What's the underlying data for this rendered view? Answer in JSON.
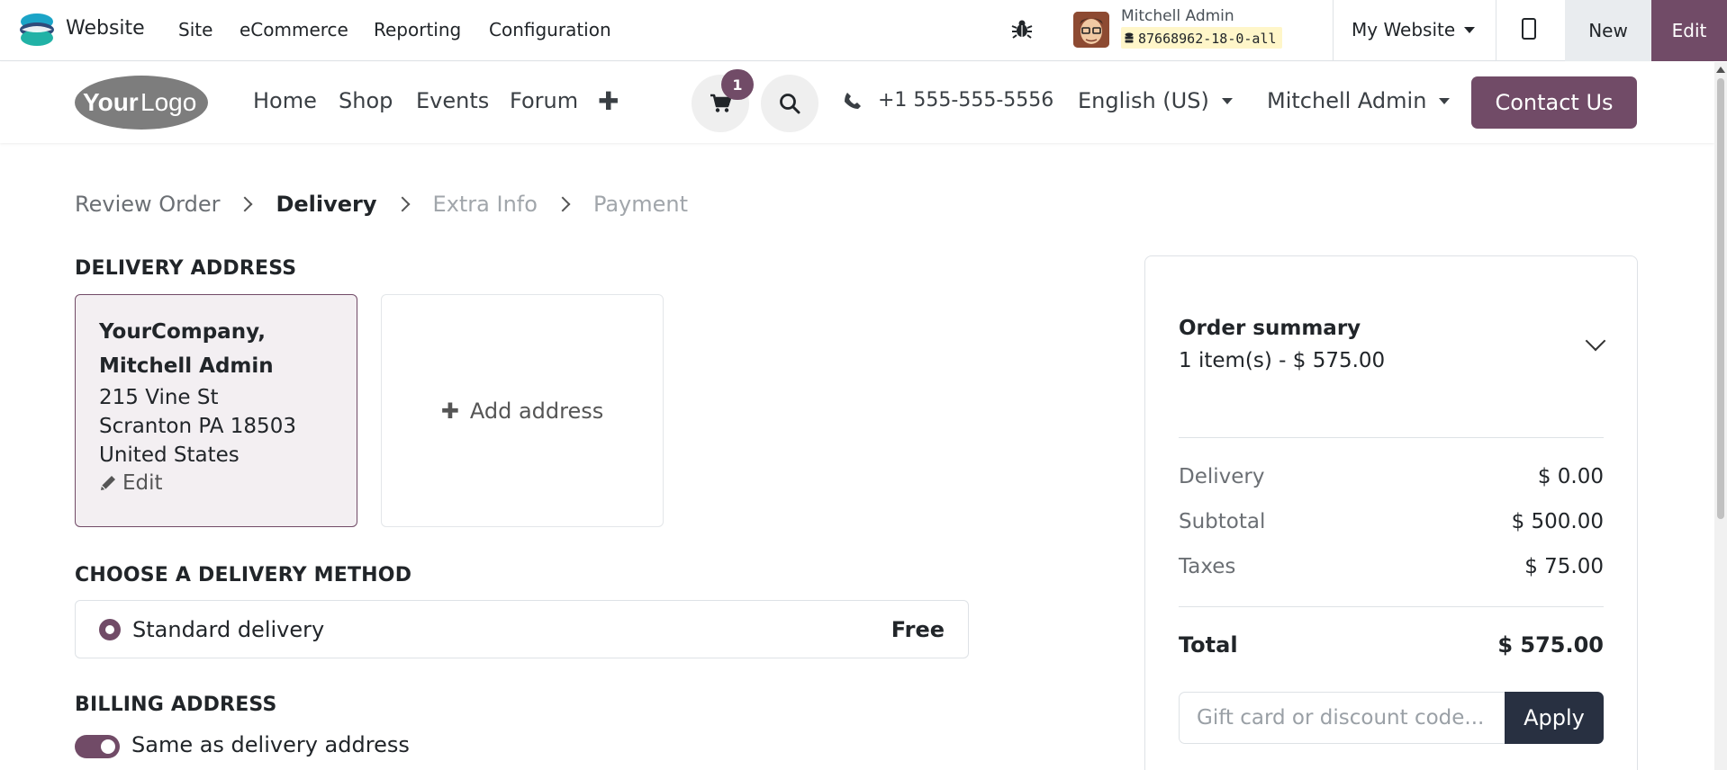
{
  "adminbar": {
    "app_name": "Website",
    "menus": [
      "Site",
      "eCommerce",
      "Reporting",
      "Configuration"
    ],
    "user_name": "Mitchell Admin",
    "db_name": "87668962-18-0-all",
    "website_select": "My Website",
    "new_label": "New",
    "edit_label": "Edit"
  },
  "header": {
    "logo_text_your": "Your",
    "logo_text_logo": "Logo",
    "nav": [
      "Home",
      "Shop",
      "Events",
      "Forum"
    ],
    "cart_count": "1",
    "phone": "+1 555-555-5556",
    "language": "English (US)",
    "user": "Mitchell Admin",
    "contact_label": "Contact Us"
  },
  "steps": [
    {
      "label": "Review Order",
      "state": "done"
    },
    {
      "label": "Delivery",
      "state": "active"
    },
    {
      "label": "Extra Info",
      "state": "disabled"
    },
    {
      "label": "Payment",
      "state": "disabled"
    }
  ],
  "delivery_address": {
    "title": "DELIVERY ADDRESS",
    "company_line1": "YourCompany,",
    "company_line2": "Mitchell Admin",
    "street": "215 Vine St",
    "city": "Scranton PA 18503",
    "country": "United States",
    "edit_label": "Edit",
    "add_label": "Add address"
  },
  "delivery_method": {
    "title": "CHOOSE A DELIVERY METHOD",
    "name": "Standard delivery",
    "price": "Free"
  },
  "billing": {
    "title": "BILLING ADDRESS",
    "toggle_label": "Same as delivery address",
    "toggle_on": true
  },
  "summary": {
    "title": "Order summary",
    "items": "1 item(s) -  $ 575.00",
    "rows": [
      {
        "label": "Delivery",
        "value": "$ 0.00"
      },
      {
        "label": "Subtotal",
        "value": "$ 500.00"
      },
      {
        "label": "Taxes",
        "value": "$ 75.00"
      }
    ],
    "total_label": "Total",
    "total_value": "$ 575.00",
    "promo_placeholder": "Gift card or discount code...",
    "apply_label": "Apply"
  },
  "colors": {
    "accent": "#714b67",
    "dark_button": "#283041",
    "db_badge": "#fff6c9"
  }
}
